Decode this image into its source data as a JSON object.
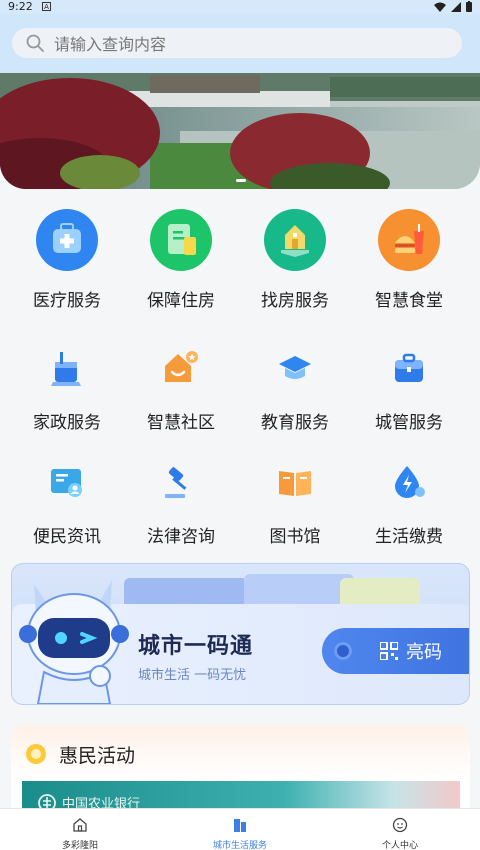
{
  "status_bar": {
    "time": "9:22",
    "notification_badge": "A"
  },
  "search": {
    "placeholder": "请输入查询内容"
  },
  "services": [
    {
      "label": "医疗服务",
      "icon": "medical-kit-icon"
    },
    {
      "label": "保障住房",
      "icon": "housing-document-icon"
    },
    {
      "label": "找房服务",
      "icon": "house-search-icon"
    },
    {
      "label": "智慧食堂",
      "icon": "burger-drink-icon"
    },
    {
      "label": "家政服务",
      "icon": "cleaning-broom-icon"
    },
    {
      "label": "智慧社区",
      "icon": "community-house-icon"
    },
    {
      "label": "教育服务",
      "icon": "graduation-cap-icon"
    },
    {
      "label": "城管服务",
      "icon": "briefcase-icon"
    },
    {
      "label": "便民资讯",
      "icon": "info-board-icon"
    },
    {
      "label": "法律咨询",
      "icon": "gavel-icon"
    },
    {
      "label": "图书馆",
      "icon": "open-book-icon"
    },
    {
      "label": "生活缴费",
      "icon": "water-drop-icon"
    }
  ],
  "city_code": {
    "title": "城市一码通",
    "subtitle": "城市生活  一码无忧",
    "button_label": "亮码"
  },
  "activity": {
    "title": "惠民活动",
    "banner_text": "中国农业银行"
  },
  "tabbar": [
    {
      "label": "多彩隆阳",
      "icon": "home-icon",
      "active": false
    },
    {
      "label": "城市生活服务",
      "icon": "city-buildings-icon",
      "active": true
    },
    {
      "label": "个人中心",
      "icon": "user-face-icon",
      "active": false
    }
  ],
  "colors": {
    "accent": "#3d7fe6",
    "header": "#cfe6fb"
  }
}
